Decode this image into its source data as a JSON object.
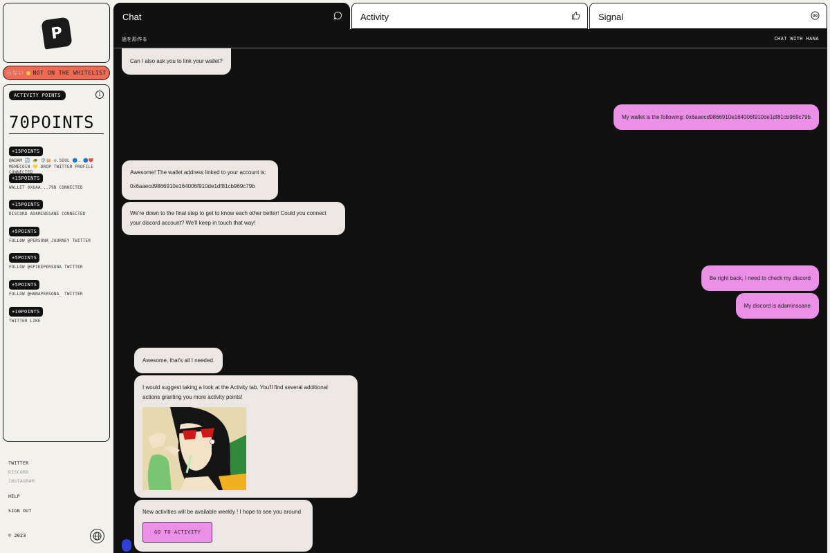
{
  "sidebar": {
    "whitelist": {
      "prefix": "らない",
      "label": "NOT ON THE WHITELIST"
    },
    "activity_points_label": "ACTIVITY POINTS",
    "total_points": "70POINTS",
    "activities": [
      {
        "points": "+15POINTS",
        "description": "@ADAM 🔄 🐢 🛡️🐹 ⊙.SOUL 🔵. 🔵❤️ MEMECOIN 💛 DROP TWITTER PROFILE CONNECTED"
      },
      {
        "points": "+15POINTS",
        "description": "WALLET 0X6AA...79B CONNECTED"
      },
      {
        "points": "+15POINTS",
        "description": "DISCORD ADAMINSSANE CONNECTED"
      },
      {
        "points": "+5POINTS",
        "description": "FOLLOW @PERSONA_JOURNEY TWITTER"
      },
      {
        "points": "+5POINTS",
        "description": "FOLLOW @SPIKEPERSONA TWITTER"
      },
      {
        "points": "+5POINTS",
        "description": "FOLLOW @HANAPERSONA_ TWITTER"
      },
      {
        "points": "+10POINTS",
        "description": "TWITTER LIKE"
      }
    ],
    "links": {
      "twitter": "TWITTER",
      "discord": "DISCORD",
      "instagram": "INSTAGRAM",
      "help": "HELP",
      "sign_out": "SIGN OUT"
    },
    "copyright": "© 2023"
  },
  "tabs": {
    "chat": "Chat",
    "activity": "Activity",
    "signal": "Signal"
  },
  "chat": {
    "header_left": "話を形作る",
    "header_right": "CHAT WITH HANA",
    "messages": {
      "m1": "Can I also ask you to link your wallet?",
      "m2": "My wallet is the following: 0x6aaecd9866910e164006f910de1df81cb969c79b",
      "m3_line1": "Awesome! The wallet address linked to your account is:",
      "m3_line2": "0x6aaecd9866910e164006f910de1df81cb969c79b",
      "m4_line1": "We're down to the final step to get to know each other better! Could you connect",
      "m4_line2": "your discord account? We'll keep in touch that way!",
      "m5": "Be right back, I need to check my discord",
      "m6": "My discord is adaminssane",
      "m7": "Awesome, that's all I needed.",
      "m8_line1": "I would suggest taking a look at the Activity tab. You'll find several additional",
      "m8_line2": "actions granting you more activity points!",
      "m9": "New activities will be available weekly ! I hope to see you around",
      "go_button": "GO TO ACTIVITY"
    }
  },
  "colors": {
    "accent_pink": "#ec8fe6",
    "whitelist_red": "#ef6a52",
    "chat_bg": "#111111",
    "bubble_bg": "#ece7e2"
  }
}
